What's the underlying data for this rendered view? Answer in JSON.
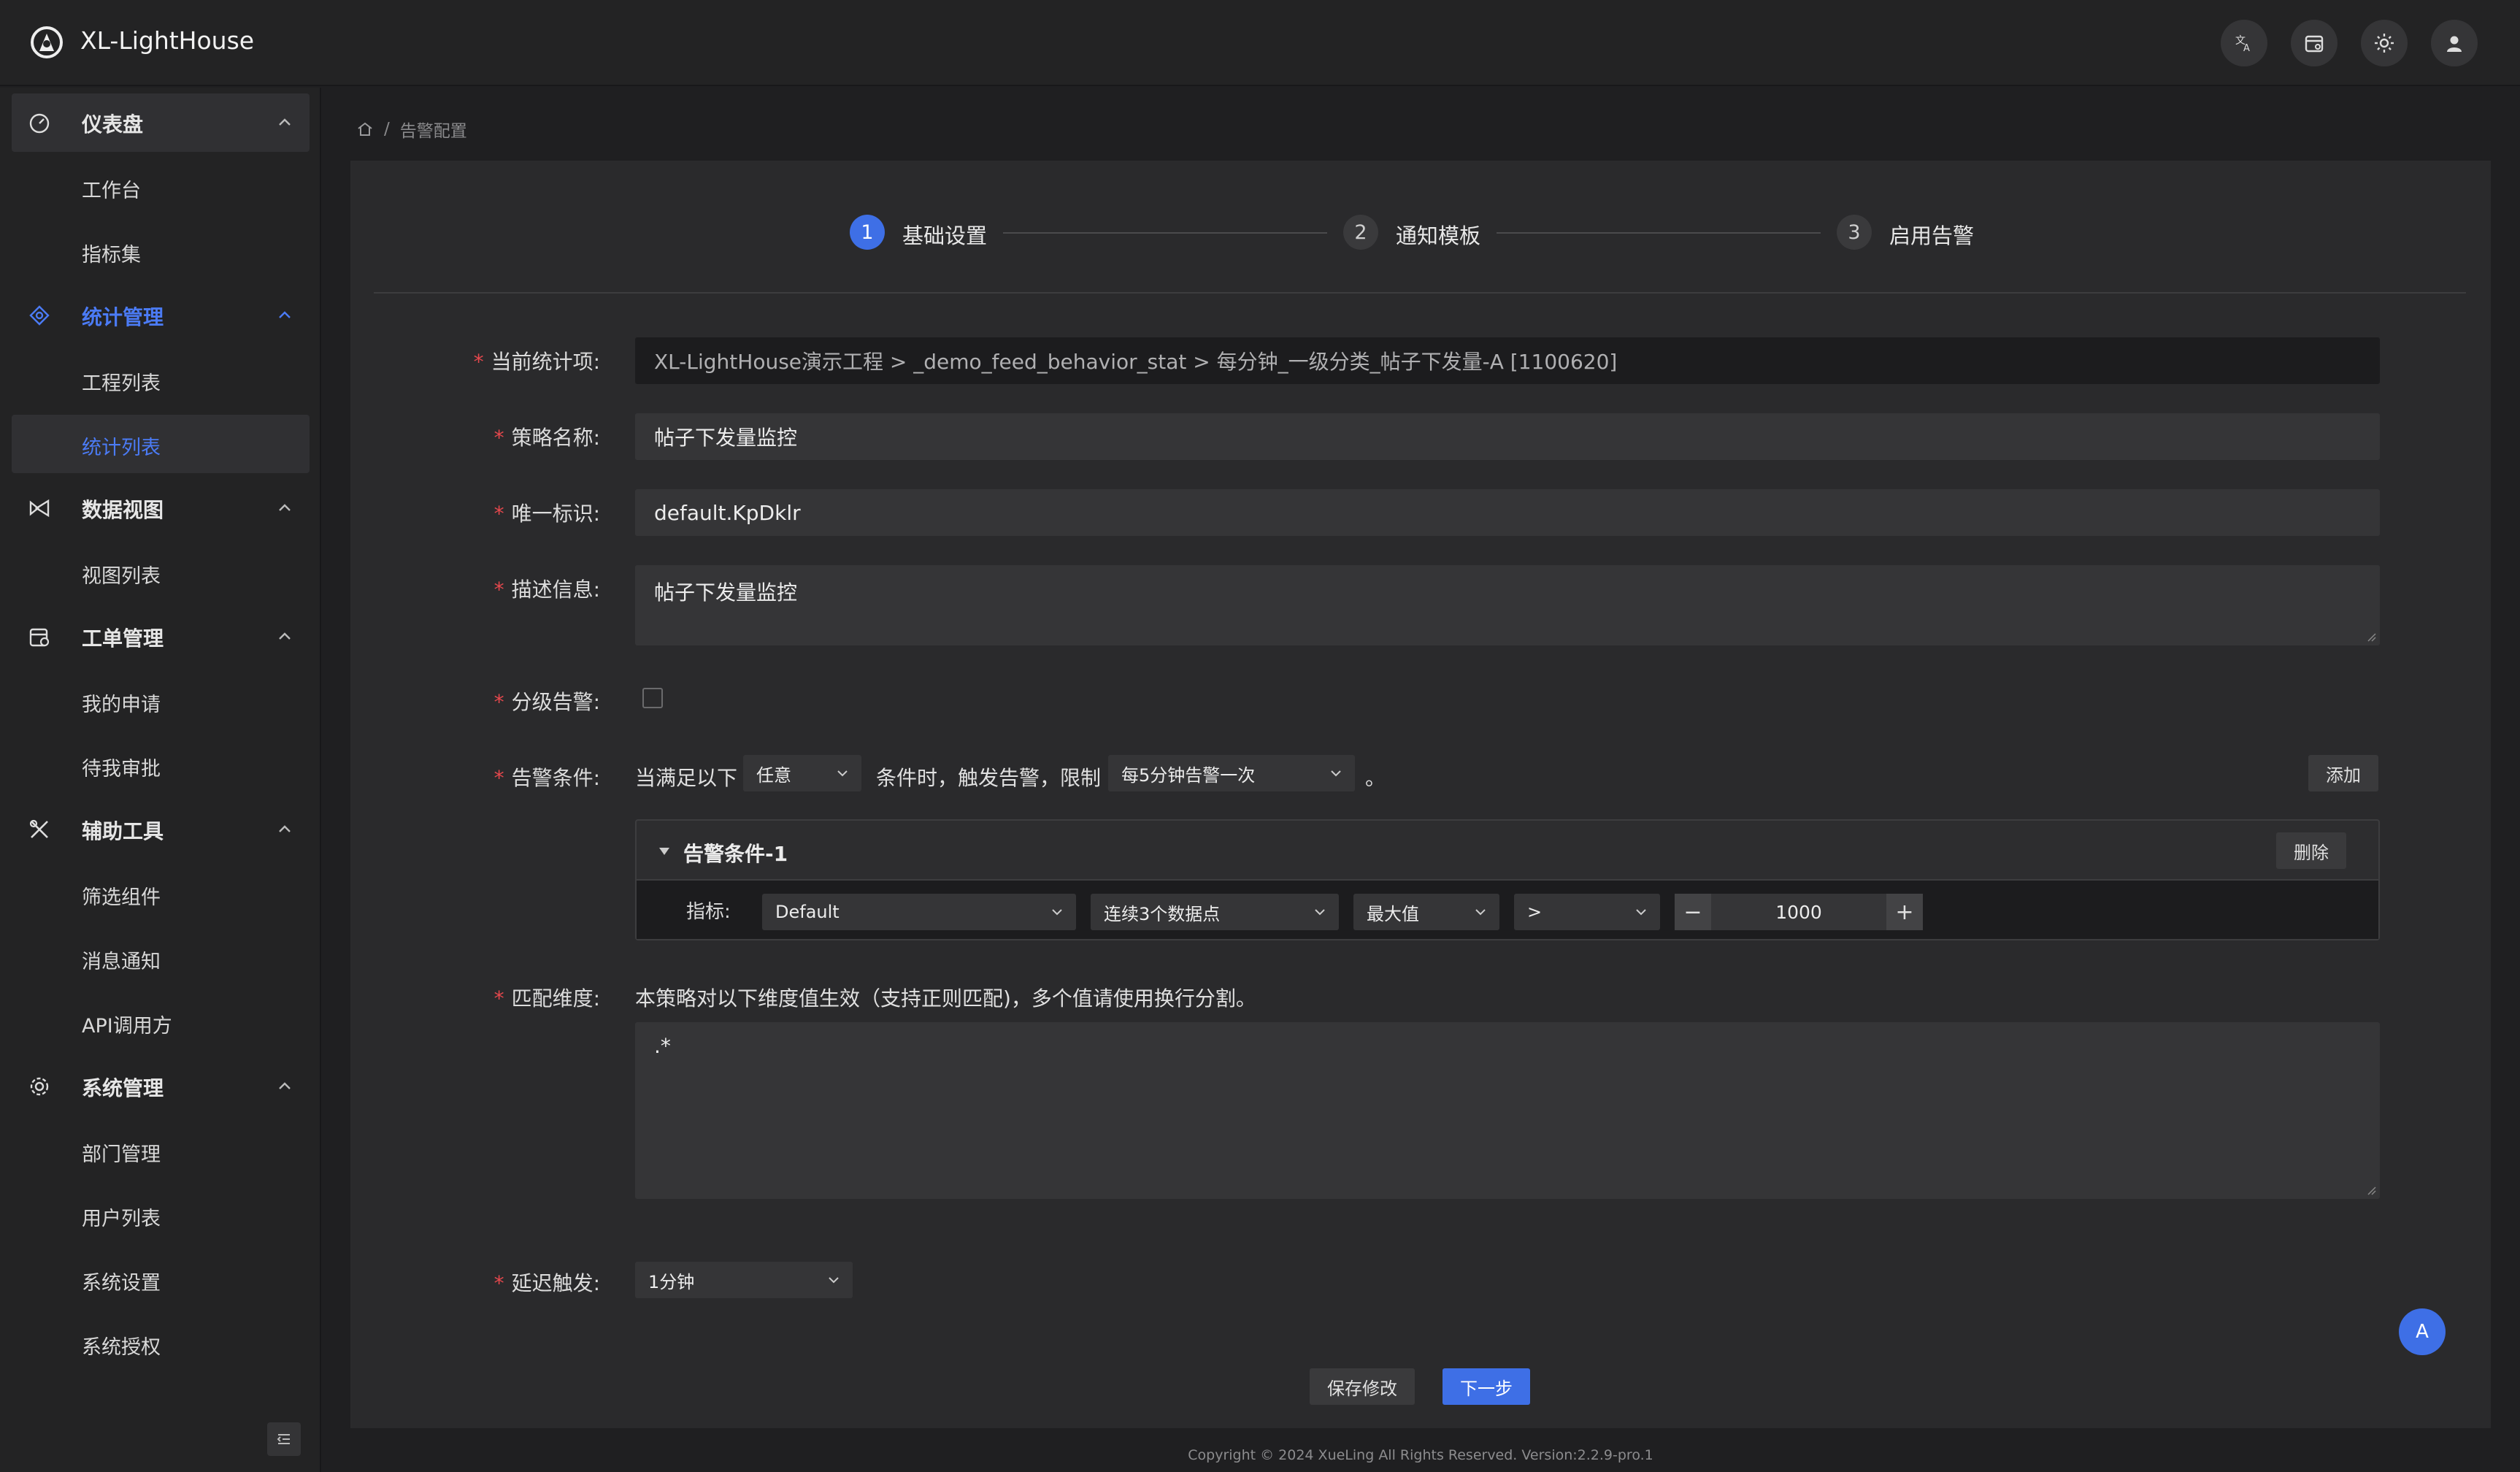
{
  "app": {
    "title": "XL-LightHouse"
  },
  "header": {
    "icons": [
      "translate-icon",
      "calendar-icon",
      "sun-icon",
      "user-icon"
    ]
  },
  "sidebar": {
    "groups": [
      {
        "label": "仪表盘",
        "icon": "dashboard-icon",
        "items": [
          "工作台",
          "指标集"
        ]
      },
      {
        "label": "统计管理",
        "icon": "stats-icon",
        "items": [
          "工程列表",
          "统计列表"
        ]
      },
      {
        "label": "数据视图",
        "icon": "view-icon",
        "items": [
          "视图列表"
        ]
      },
      {
        "label": "工单管理",
        "icon": "order-icon",
        "items": [
          "我的申请",
          "待我审批"
        ]
      },
      {
        "label": "辅助工具",
        "icon": "tools-icon",
        "items": [
          "筛选组件",
          "消息通知",
          "API调用方"
        ]
      },
      {
        "label": "系统管理",
        "icon": "settings-icon",
        "items": [
          "部门管理",
          "用户列表",
          "系统设置",
          "系统授权"
        ]
      }
    ],
    "active_group": "统计管理",
    "active_item": "统计列表"
  },
  "breadcrumb": {
    "current": "告警配置"
  },
  "steps": [
    {
      "num": "1",
      "label": "基础设置"
    },
    {
      "num": "2",
      "label": "通知模板"
    },
    {
      "num": "3",
      "label": "启用告警"
    }
  ],
  "form": {
    "current_stat_label": "当前统计项:",
    "current_stat_value": "XL-LightHouse演示工程 > _demo_feed_behavior_stat > 每分钟_一级分类_帖子下发量-A [1100620]",
    "strategy_name_label": "策略名称:",
    "strategy_name_value": "帖子下发量监控",
    "unique_id_label": "唯一标识:",
    "unique_id_value": "default.KpDklr",
    "description_label": "描述信息:",
    "description_value": "帖子下发量监控",
    "level_alarm_label": "分级告警:",
    "condition_label": "告警条件:",
    "condition_prefix": "当满足以下",
    "condition_mode": "任意",
    "condition_middle": "条件时，触发告警，限制",
    "condition_limit": "每5分钟告警一次",
    "condition_suffix": "。",
    "add_button": "添加",
    "condition_item": {
      "title": "告警条件-1",
      "delete_button": "删除",
      "metric_label": "指标:",
      "metric": "Default",
      "datapoints": "连续3个数据点",
      "aggregate": "最大值",
      "operator": ">",
      "threshold": "1000"
    },
    "dimension_label": "匹配维度:",
    "dimension_hint": "本策略对以下维度值生效（支持正则匹配)，多个值请使用换行分割。",
    "dimension_value": ".*",
    "delay_label": "延迟触发:",
    "delay_value": "1分钟"
  },
  "actions": {
    "save": "保存修改",
    "next": "下一步"
  },
  "float_button": "A",
  "footer": "Copyright © 2024 XueLing All Rights Reserved.    Version:2.2.9-pro.1"
}
